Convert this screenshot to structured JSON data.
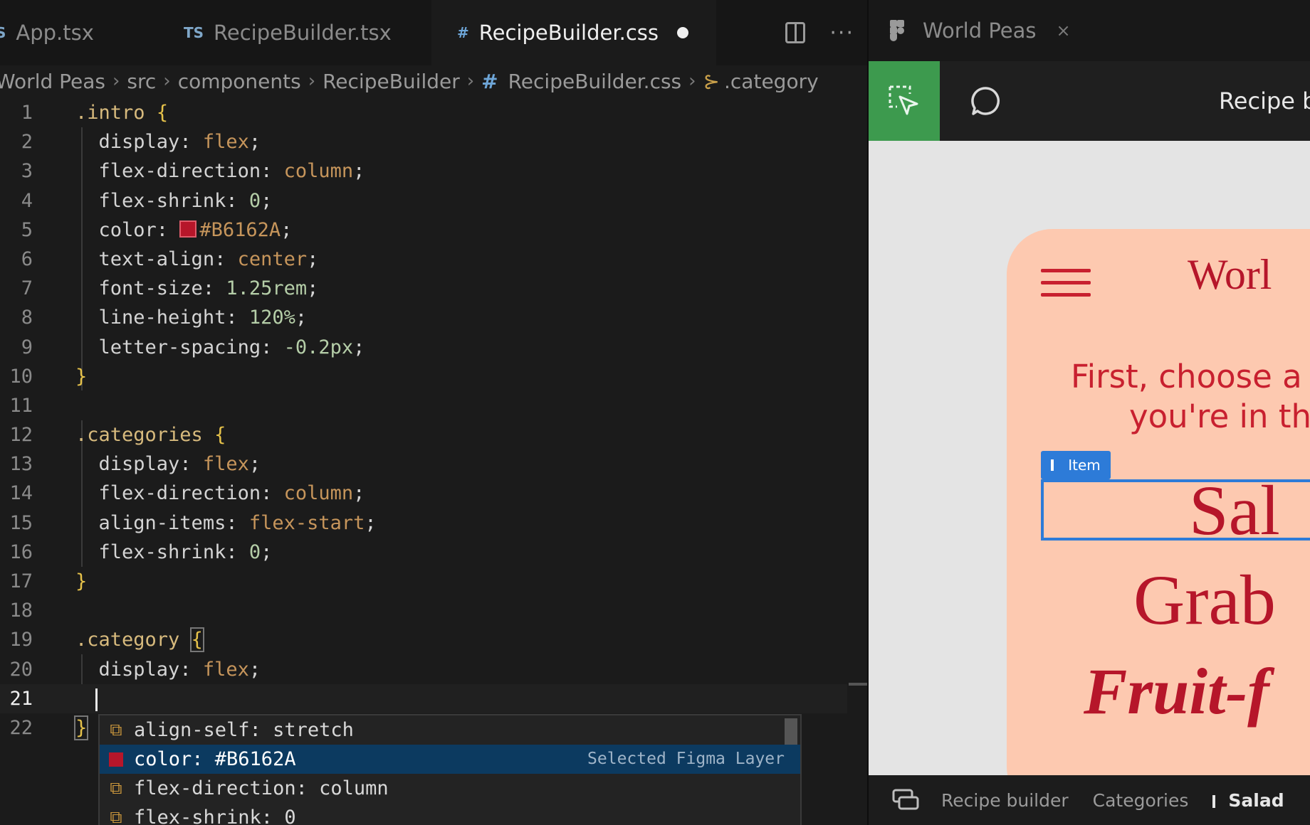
{
  "editor": {
    "tabs": [
      {
        "icon": "S",
        "label": "App.tsx",
        "active": false
      },
      {
        "icon": "TS",
        "label": "RecipeBuilder.tsx",
        "active": false
      },
      {
        "icon": "#",
        "label": "RecipeBuilder.css",
        "active": true,
        "modified": true
      }
    ],
    "breadcrumb": [
      "World Peas",
      "src",
      "components",
      "RecipeBuilder",
      "RecipeBuilder.css",
      ".category"
    ],
    "lines": [
      {
        "n": "1"
      },
      {
        "n": "2"
      },
      {
        "n": "3"
      },
      {
        "n": "4"
      },
      {
        "n": "5"
      },
      {
        "n": "6"
      },
      {
        "n": "7"
      },
      {
        "n": "8"
      },
      {
        "n": "9"
      },
      {
        "n": "10"
      },
      {
        "n": "11"
      },
      {
        "n": "12"
      },
      {
        "n": "13"
      },
      {
        "n": "14"
      },
      {
        "n": "15"
      },
      {
        "n": "16"
      },
      {
        "n": "17"
      },
      {
        "n": "18"
      },
      {
        "n": "19"
      },
      {
        "n": "20"
      },
      {
        "n": "21"
      },
      {
        "n": "22"
      }
    ],
    "code": {
      "l1_sel": ".intro",
      "l1_brace": "{",
      "l2_prop": "display",
      "l2_val": "flex",
      "l3_prop": "flex-direction",
      "l3_val": "column",
      "l4_prop": "flex-shrink",
      "l4_val": "0",
      "l5_prop": "color",
      "l5_val": "#B6162A",
      "l6_prop": "text-align",
      "l6_val": "center",
      "l7_prop": "font-size",
      "l7_val": "1.25rem",
      "l8_prop": "line-height",
      "l8_val": "120%",
      "l9_prop": "letter-spacing",
      "l9_val": "-0.2px",
      "l10_brace": "}",
      "l12_sel": ".categories",
      "l12_brace": "{",
      "l13_prop": "display",
      "l13_val": "flex",
      "l14_prop": "flex-direction",
      "l14_val": "column",
      "l15_prop": "align-items",
      "l15_val": "flex-start",
      "l16_prop": "flex-shrink",
      "l16_val": "0",
      "l17_brace": "}",
      "l19_sel": ".category",
      "l19_brace": "{",
      "l20_prop": "display",
      "l20_val": "flex",
      "l22_brace": "}"
    },
    "swatch_color": "#B6162A",
    "suggestions": [
      {
        "label": "align-self: stretch",
        "icon": "property-icon",
        "detail": ""
      },
      {
        "label": "color: #B6162A",
        "icon": "color-swatch-icon",
        "detail": "Selected Figma Layer",
        "active": true
      },
      {
        "label": "flex-direction: column",
        "icon": "property-icon",
        "detail": ""
      },
      {
        "label": "flex-shrink: 0",
        "icon": "property-icon",
        "detail": ""
      }
    ]
  },
  "figma": {
    "tab_label": "World Peas",
    "toolbar_title": "Recipe b",
    "canvas": {
      "brand": "Worl",
      "intro_line1": "First, choose a",
      "intro_line2": "you're in th",
      "badge": "Item",
      "categories": [
        "Sal",
        "Grab",
        "Fruit-f"
      ]
    },
    "status_breadcrumb": [
      "Recipe builder",
      "Categories",
      "Salad"
    ],
    "accent_green": "#3D9A4E",
    "selection_blue": "#2D7BD8",
    "brand_red": "#B6162A"
  }
}
